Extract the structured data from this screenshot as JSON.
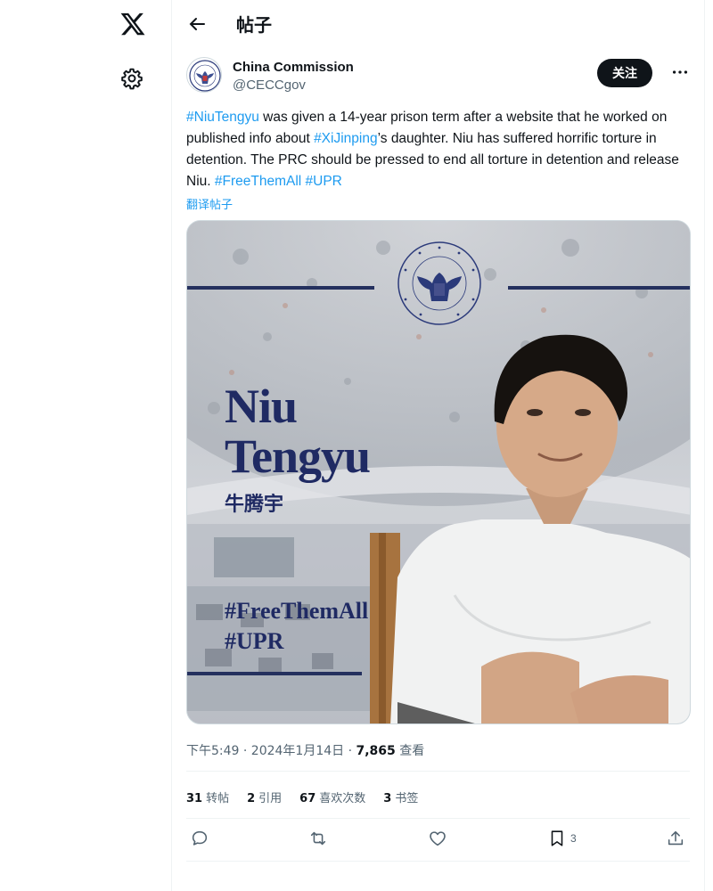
{
  "header": {
    "title": "帖子"
  },
  "author": {
    "name": "China Commission",
    "handle": "@CECCgov",
    "follow_label": "关注"
  },
  "tweet": {
    "tag1": "#NiuTengyu",
    "text1": " was given a 14-year prison term after a website that he worked on published info about ",
    "tag2": "#XiJinping",
    "text2": "’s daughter. Niu has suffered horrific torture in detention. The PRC should be pressed to end all torture in detention and release Niu. ",
    "tag3": "#FreeThemAll",
    "tag4": "#UPR",
    "translate_label": "翻译帖子"
  },
  "media": {
    "seal_text": "CONGRESSIONAL-EXECUTIVE COMMISSION ON CHINA",
    "name_line1": "Niu",
    "name_line2": "Tengyu",
    "name_cn": "牛腾宇",
    "hashtag1": "#FreeThemAll",
    "hashtag2": "#UPR"
  },
  "meta": {
    "time_date": "下午5:49 · 2024年1月14日 · ",
    "views_count": "7,865",
    "views_label": " 查看"
  },
  "stats": [
    {
      "count": "31",
      "label": "转帖"
    },
    {
      "count": "2",
      "label": "引用"
    },
    {
      "count": "67",
      "label": "喜欢次数"
    },
    {
      "count": "3",
      "label": "书签"
    }
  ],
  "actions": {
    "bookmark_count": "3"
  },
  "colors": {
    "accent": "#1d9bf0",
    "text": "#0f1419",
    "muted": "#536471",
    "poster_navy": "#1f2a63"
  }
}
